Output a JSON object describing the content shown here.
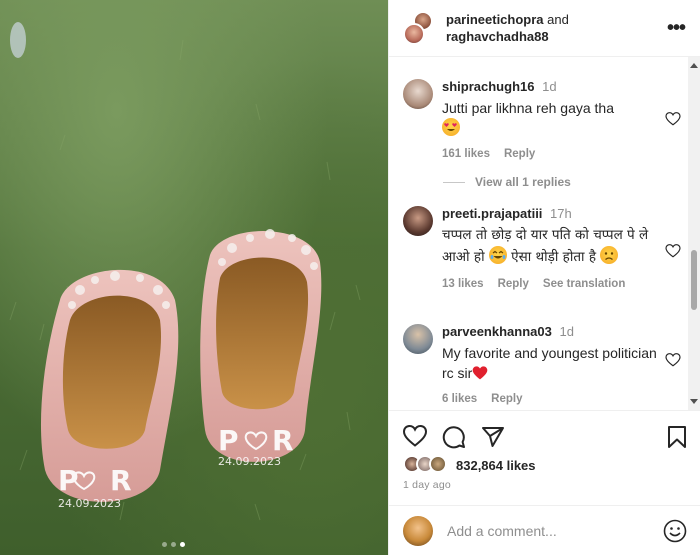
{
  "post": {
    "photo_alt": "Pink embroidered juttis on grass",
    "shoe_initials": "P ♥ R",
    "shoe_date": "24.09.2023",
    "carousel_dots": 3,
    "carousel_active": 3
  },
  "header": {
    "user1": "parineetichopra",
    "conjunction": "and",
    "user2": "raghavchadha88",
    "more_icon": "more-horizontal-icon"
  },
  "comments": [
    {
      "username": "shiprachugh16",
      "time": "1d",
      "text": "Jutti par likhna reh gaya tha",
      "emoji": "heart-eyes",
      "likes": "161 likes",
      "reply": "Reply",
      "translate": ""
    },
    {
      "username": "preeti.prajapatiii",
      "time": "17h",
      "text_part1": "चप्पल तो छोड़ दो यार पति को चप्पल पे ले आओ हो",
      "text_part2": "ऐसा थोड़ी होता है",
      "likes": "13 likes",
      "reply": "Reply",
      "translate": "See translation"
    },
    {
      "username": "parveenkhanna03",
      "time": "1d",
      "text": "My favorite and youngest politician rc sir",
      "emoji": "red-heart",
      "likes": "6 likes",
      "reply": "Reply"
    }
  ],
  "view_replies": "View all 1 replies",
  "actions": {
    "like_icon": "heart-icon",
    "comment_icon": "comment-icon",
    "share_icon": "send-icon",
    "save_icon": "bookmark-icon"
  },
  "likes": "832,864 likes",
  "post_time": "1 day ago",
  "add_comment": {
    "placeholder": "Add a comment...",
    "emoji_icon": "emoji-icon"
  },
  "colors": {
    "text": "#262626",
    "secondary": "#8e8e8e",
    "divider": "#efefef",
    "shoe_pink": "#e6b3ae"
  }
}
